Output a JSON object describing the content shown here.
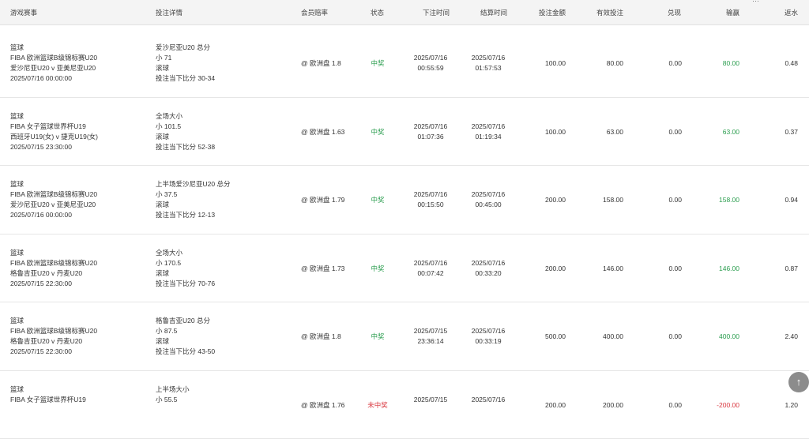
{
  "headers": {
    "game": "游戏赛事",
    "detail": "投注详情",
    "odds": "会员赔率",
    "status": "状态",
    "bet_time": "下注时间",
    "settle_time": "结算时间",
    "amount": "投注金额",
    "valid": "有效投注",
    "cashout": "兑现",
    "winloss": "输赢",
    "rebate": "返水"
  },
  "rows": [
    {
      "sport": "篮球",
      "league": "FIBA 欧洲篮球B级锦标赛U20",
      "match": "爱沙尼亚U20 v 亚美尼亚U20",
      "match_time": "2025/07/16 00:00:00",
      "d1": "爱沙尼亚U20 总分",
      "d2": "小 71",
      "d3": "滚球",
      "d4": "投注当下比分 30-34",
      "odds": "@ 欧洲盘 1.8",
      "status": "中奖",
      "status_type": "win",
      "bet_date": "2025/07/16",
      "bet_clock": "00:55:59",
      "settle_date": "2025/07/16",
      "settle_clock": "01:57:53",
      "amount": "100.00",
      "valid": "80.00",
      "cashout": "0.00",
      "winloss": "80.00",
      "rebate": "0.48"
    },
    {
      "sport": "篮球",
      "league": "FIBA 女子篮球世界杯U19",
      "match": "西班牙U19(女) v 捷克U19(女)",
      "match_time": "2025/07/15 23:30:00",
      "d1": "全场大小",
      "d2": "小 101.5",
      "d3": "滚球",
      "d4": "投注当下比分 52-38",
      "odds": "@ 欧洲盘 1.63",
      "status": "中奖",
      "status_type": "win",
      "bet_date": "2025/07/16",
      "bet_clock": "01:07:36",
      "settle_date": "2025/07/16",
      "settle_clock": "01:19:34",
      "amount": "100.00",
      "valid": "63.00",
      "cashout": "0.00",
      "winloss": "63.00",
      "rebate": "0.37"
    },
    {
      "sport": "篮球",
      "league": "FIBA 欧洲篮球B级锦标赛U20",
      "match": "爱沙尼亚U20 v 亚美尼亚U20",
      "match_time": "2025/07/16 00:00:00",
      "d1": "上半场爱沙尼亚U20 总分",
      "d2": "小 37.5",
      "d3": "滚球",
      "d4": "投注当下比分 12-13",
      "odds": "@ 欧洲盘 1.79",
      "status": "中奖",
      "status_type": "win",
      "bet_date": "2025/07/16",
      "bet_clock": "00:15:50",
      "settle_date": "2025/07/16",
      "settle_clock": "00:45:00",
      "amount": "200.00",
      "valid": "158.00",
      "cashout": "0.00",
      "winloss": "158.00",
      "rebate": "0.94"
    },
    {
      "sport": "篮球",
      "league": "FIBA 欧洲篮球B级锦标赛U20",
      "match": "格鲁吉亚U20 v 丹麦U20",
      "match_time": "2025/07/15 22:30:00",
      "d1": "全场大小",
      "d2": "小 170.5",
      "d3": "滚球",
      "d4": "投注当下比分 70-76",
      "odds": "@ 欧洲盘 1.73",
      "status": "中奖",
      "status_type": "win",
      "bet_date": "2025/07/16",
      "bet_clock": "00:07:42",
      "settle_date": "2025/07/16",
      "settle_clock": "00:33:20",
      "amount": "200.00",
      "valid": "146.00",
      "cashout": "0.00",
      "winloss": "146.00",
      "rebate": "0.87"
    },
    {
      "sport": "篮球",
      "league": "FIBA 欧洲篮球B级锦标赛U20",
      "match": "格鲁吉亚U20 v 丹麦U20",
      "match_time": "2025/07/15 22:30:00",
      "d1": "格鲁吉亚U20 总分",
      "d2": "小 87.5",
      "d3": "滚球",
      "d4": "投注当下比分 43-50",
      "odds": "@ 欧洲盘 1.8",
      "status": "中奖",
      "status_type": "win",
      "bet_date": "2025/07/15",
      "bet_clock": "23:36:14",
      "settle_date": "2025/07/16",
      "settle_clock": "00:33:19",
      "amount": "500.00",
      "valid": "400.00",
      "cashout": "0.00",
      "winloss": "400.00",
      "rebate": "2.40"
    },
    {
      "sport": "篮球",
      "league": "FIBA 女子篮球世界杯U19",
      "match": "",
      "match_time": "",
      "d1": "上半场大小",
      "d2": "小 55.5",
      "d3": "",
      "d4": "",
      "odds": "@ 欧洲盘 1.76",
      "status": "未中奖",
      "status_type": "lose",
      "bet_date": "2025/07/15",
      "bet_clock": "",
      "settle_date": "2025/07/16",
      "settle_clock": "",
      "amount": "200.00",
      "valid": "200.00",
      "cashout": "0.00",
      "winloss": "-200.00",
      "rebate": "1.20"
    }
  ],
  "scroll_top_icon": "arrow-up-icon",
  "colors": {
    "win": "#2a9d4e",
    "lose": "#d9363e",
    "header_bg": "#f4f4f4"
  }
}
